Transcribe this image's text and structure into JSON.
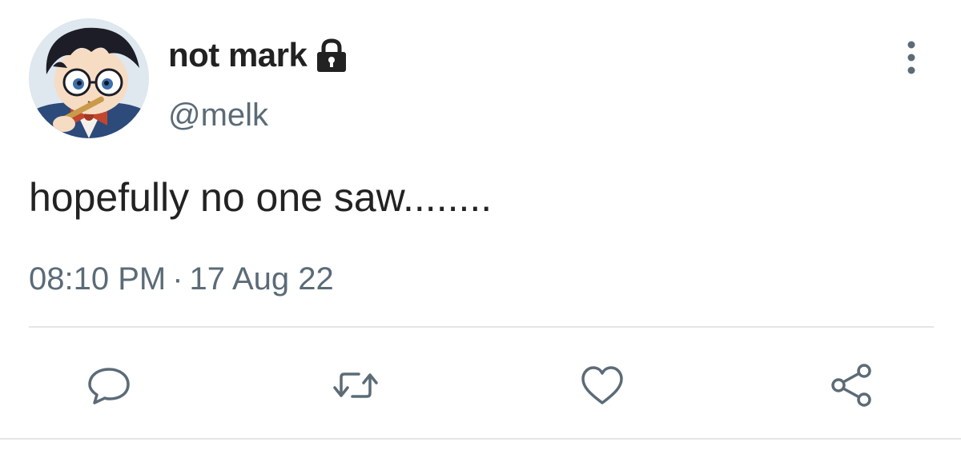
{
  "tweet": {
    "author": {
      "display_name": "not mark",
      "handle": "@melk",
      "protected_icon": "lock-icon",
      "avatar": "anime-character-avatar"
    },
    "text": "hopefully no one saw........",
    "time": "08:10 PM",
    "separator": "·",
    "date": "17 Aug 22"
  },
  "actions": [
    "reply-icon",
    "retweet-icon",
    "like-icon",
    "share-icon"
  ],
  "more_menu_icon": "vertical-dots-icon",
  "colors": {
    "text": "#222222",
    "secondary_text": "#5b6b77",
    "divider": "#e3e6e8",
    "background": "#ffffff"
  }
}
